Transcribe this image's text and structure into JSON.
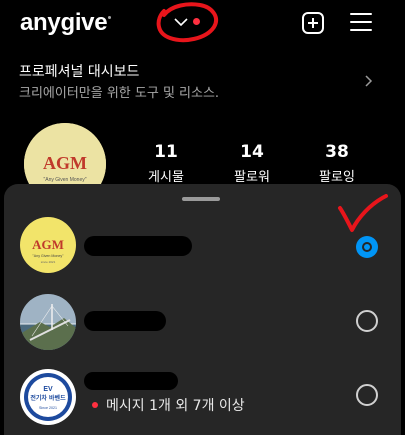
{
  "header": {
    "logo": "anygive",
    "add_label": "",
    "menu_label": ""
  },
  "dashboard": {
    "title": "프로페셔널 대시보드",
    "subtitle": "크리에이터만을 위한 도구 및 리소스."
  },
  "profile": {
    "stats": [
      {
        "num": "11",
        "label": "게시물"
      },
      {
        "num": "14",
        "label": "팔로워"
      },
      {
        "num": "38",
        "label": "팔로잉"
      }
    ],
    "logo_main": "AGM",
    "logo_sub": "\"Any Given Money\""
  },
  "accounts": [
    {
      "selected": true,
      "logo_main": "AGM",
      "logo_sub": "\"Any Given Money\"",
      "logo_since": "since 2021"
    },
    {
      "selected": false
    },
    {
      "selected": false,
      "logo_top": "EV",
      "logo_main": "전기차 바벤드",
      "logo_since": "Since 2021",
      "message": "메시지 1개 외 7개 이상"
    }
  ],
  "colors": {
    "accent": "#0095f6",
    "notification": "#ff3040",
    "sheet_bg": "#262626",
    "annotation": "#e8151b"
  }
}
